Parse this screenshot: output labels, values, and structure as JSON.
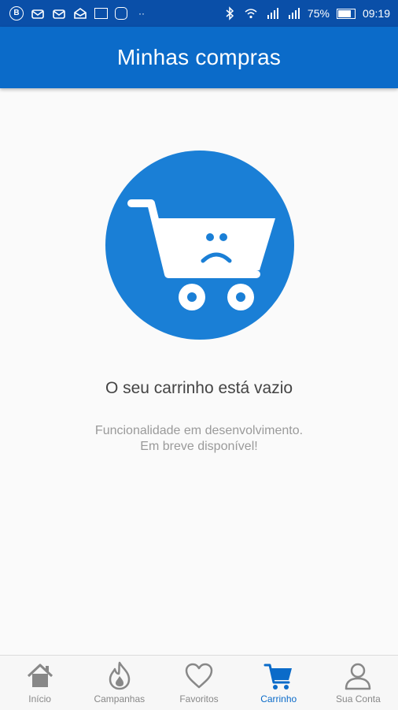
{
  "status_bar": {
    "battery": "75%",
    "battery_level": 0.75,
    "time": "09:19",
    "ellipsis": "··",
    "badge_letter": "B"
  },
  "app_bar": {
    "title": "Minhas compras"
  },
  "empty_state": {
    "title": "O seu carrinho está vazio",
    "subtitle_line1": "Funcionalidade em desenvolvimento.",
    "subtitle_line2": "Em breve disponível!"
  },
  "colors": {
    "primary": "#0b6bc9",
    "status_bar": "#0a4fa8",
    "illustration_circle": "#1a7fd6",
    "inactive": "#888888"
  },
  "bottom_nav": {
    "active": "Carrinho",
    "items": [
      {
        "label": "Início",
        "icon": "home-icon"
      },
      {
        "label": "Campanhas",
        "icon": "flame-icon"
      },
      {
        "label": "Favoritos",
        "icon": "heart-icon"
      },
      {
        "label": "Carrinho",
        "icon": "cart-icon"
      },
      {
        "label": "Sua Conta",
        "icon": "user-icon"
      }
    ]
  }
}
